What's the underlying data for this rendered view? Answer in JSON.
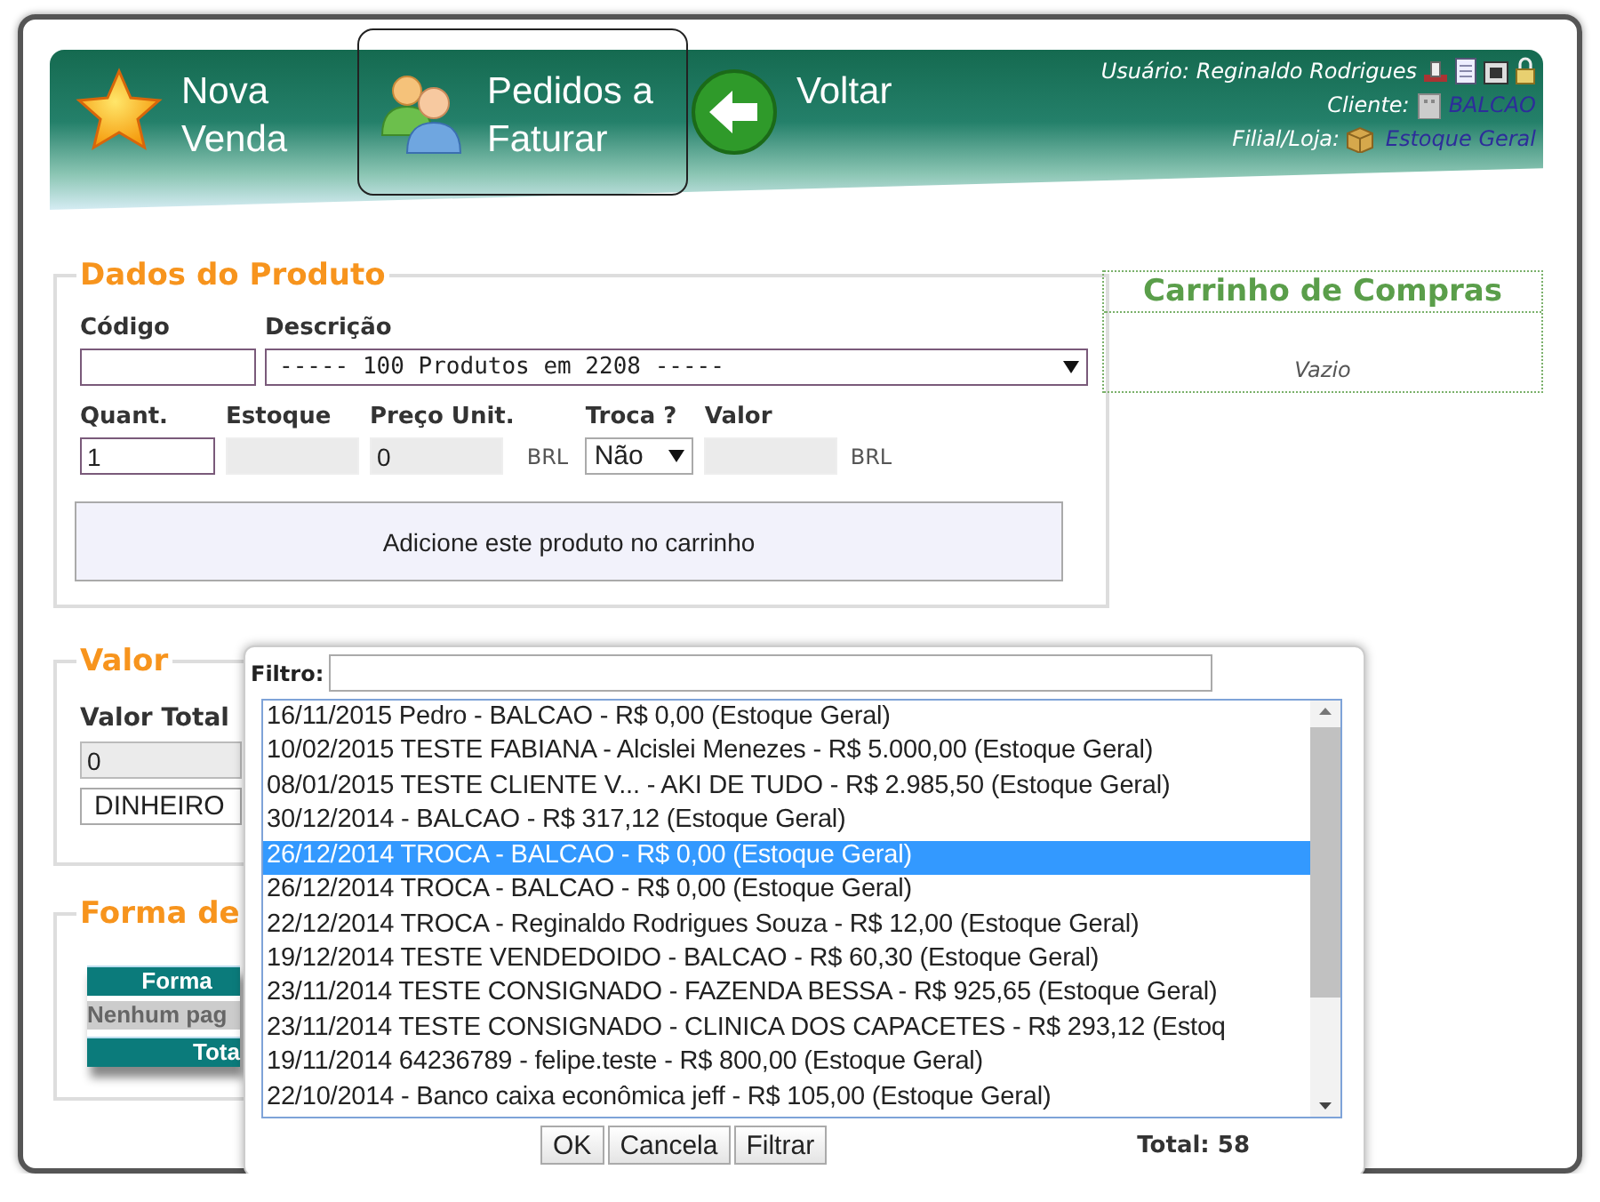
{
  "header": {
    "nav": [
      {
        "kind": "star",
        "label": "Nova\nVenda",
        "selected": false
      },
      {
        "kind": "people",
        "label": "Pedidos a\nFaturar",
        "selected": true
      },
      {
        "kind": "back",
        "label": "Voltar",
        "selected": false
      }
    ],
    "user": "Usuário: Reginaldo Rodrigues",
    "client_label": "Cliente:",
    "client": "BALCAO",
    "store_label": "Filial/Loja:",
    "store": "Estoque Geral"
  },
  "product": {
    "legend": "Dados do Produto",
    "code_label": "Código",
    "description_label": "Descrição",
    "description": "----- 100 Produtos em 2208 -----",
    "quantity_label": "Quant.",
    "quantity": "1",
    "stock_label": "Estoque",
    "price_label": "Preço Unit.",
    "price": "0",
    "price_currency": "BRL",
    "exchange_label": "Troca ?",
    "exchange": "Não",
    "value_label": "Valor",
    "value_currency": "BRL",
    "add_button": "Adicione este produto no carrinho"
  },
  "cart": {
    "title": "Carrinho de Compras",
    "empty": "Vazio"
  },
  "value": {
    "legend": "Valor",
    "total_label": "Valor Total",
    "total": "0",
    "method": "DINHEIRO"
  },
  "payment": {
    "legend": "Forma de",
    "header": "Forma",
    "empty_row": "Nenhum pag",
    "total_row": "Tota"
  },
  "dialog": {
    "filter_label": "Filtro:",
    "items": [
      {
        "text": "16/11/2015 Pedro - BALCAO - R$ 0,00 (Estoque Geral)",
        "selected": false
      },
      {
        "text": "10/02/2015 TESTE FABIANA - Alcislei Menezes - R$ 5.000,00 (Estoque Geral)",
        "selected": false
      },
      {
        "text": "08/01/2015 TESTE CLIENTE V... - AKI DE TUDO - R$ 2.985,50 (Estoque Geral)",
        "selected": false
      },
      {
        "text": "30/12/2014 - BALCAO - R$ 317,12 (Estoque Geral)",
        "selected": false
      },
      {
        "text": "26/12/2014 TROCA - BALCAO - R$ 0,00 (Estoque Geral)",
        "selected": true
      },
      {
        "text": "26/12/2014 TROCA - BALCAO - R$ 0,00 (Estoque Geral)",
        "selected": false
      },
      {
        "text": "22/12/2014 TROCA - Reginaldo Rodrigues Souza - R$ 12,00 (Estoque Geral)",
        "selected": false
      },
      {
        "text": "19/12/2014 TESTE VENDEDOIDO - BALCAO - R$ 60,30 (Estoque Geral)",
        "selected": false
      },
      {
        "text": "23/11/2014 TESTE CONSIGNADO - FAZENDA BESSA - R$ 925,65 (Estoque Geral)",
        "selected": false
      },
      {
        "text": "23/11/2014 TESTE CONSIGNADO - CLINICA DOS CAPACETES - R$ 293,12 (Estoq",
        "selected": false
      },
      {
        "text": "19/11/2014 64236789 - felipe.teste - R$ 800,00 (Estoque Geral)",
        "selected": false
      },
      {
        "text": "22/10/2014 - Banco caixa econômica jeff - R$ 105,00 (Estoque Geral)",
        "selected": false
      }
    ],
    "buttons": [
      "OK",
      "Cancela",
      "Filtrar"
    ],
    "total": "Total: 58"
  }
}
